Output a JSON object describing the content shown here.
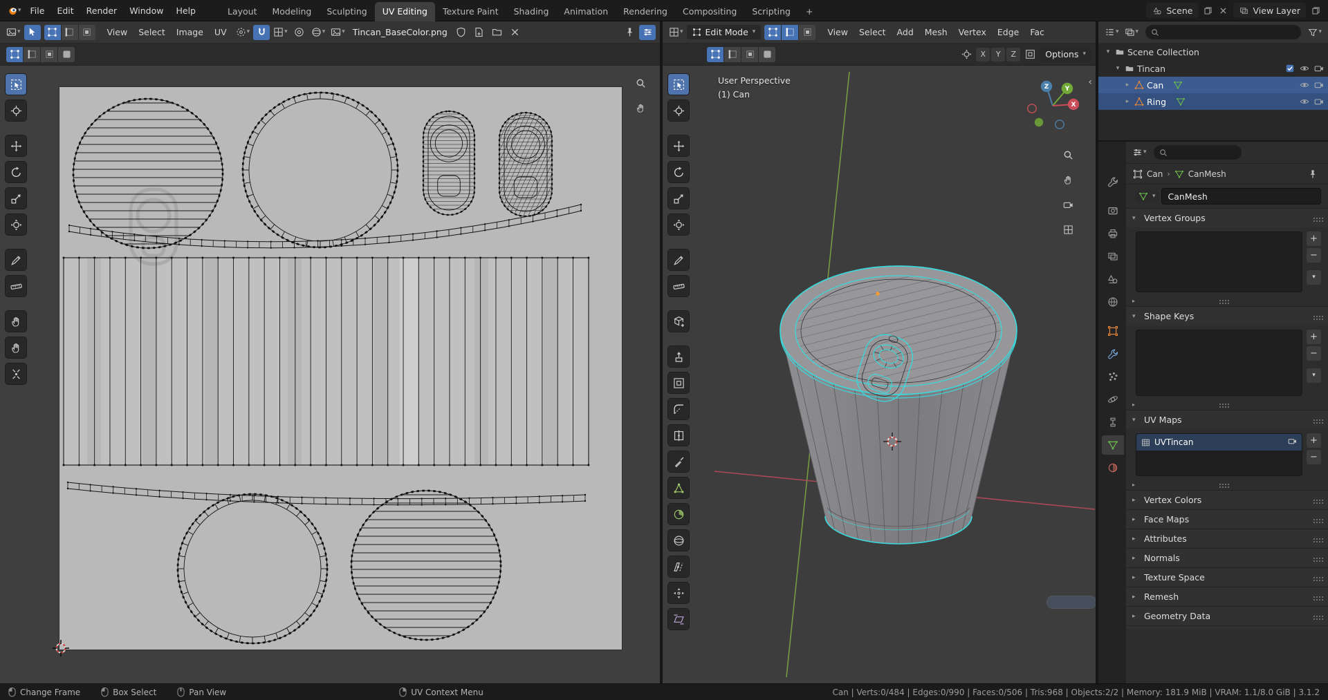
{
  "glyphs": {
    "caret": "▾",
    "right": "▸",
    "play": "▶",
    "close": "×",
    "plus": "+",
    "minus": "−",
    "chl": "‹",
    "sep": "›"
  },
  "topbar": {
    "menus": [
      "File",
      "Edit",
      "Render",
      "Window",
      "Help"
    ],
    "tabs": [
      "Layout",
      "Modeling",
      "Sculpting",
      "UV Editing",
      "Texture Paint",
      "Shading",
      "Animation",
      "Rendering",
      "Compositing",
      "Scripting"
    ],
    "add_tab": "+",
    "scene": "Scene",
    "view_layer": "View Layer"
  },
  "uv": {
    "menus": [
      "View",
      "Select",
      "Image",
      "UV"
    ],
    "image_name": "Tincan_BaseColor.png"
  },
  "viewport": {
    "mode": "Edit Mode",
    "menus": [
      "View",
      "Select",
      "Add",
      "Mesh",
      "Vertex",
      "Edge",
      "Fac"
    ],
    "overlay1": "User Perspective",
    "overlay2": "(1) Can",
    "axes": {
      "x": "X",
      "y": "Y",
      "z": "Z"
    },
    "toggles": [
      "X",
      "Y",
      "Z"
    ],
    "options": "Options"
  },
  "outliner": {
    "scene_collection": "Scene Collection",
    "collection": "Tincan",
    "can": "Can",
    "ring": "Ring"
  },
  "properties": {
    "breadcrumb_object": "Can",
    "breadcrumb_data": "CanMesh",
    "name": "CanMesh",
    "uv_item": "UVTincan",
    "panels": {
      "vertex_groups": "Vertex Groups",
      "shape_keys": "Shape Keys",
      "uv_maps": "UV Maps",
      "vertex_colors": "Vertex Colors",
      "face_maps": "Face Maps",
      "attributes": "Attributes",
      "normals": "Normals",
      "texture_space": "Texture Space",
      "remesh": "Remesh",
      "geometry_data": "Geometry Data"
    }
  },
  "statusbar": {
    "hints": [
      "Change Frame",
      "Box Select",
      "Pan View",
      "UV Context Menu"
    ],
    "stats": "Can | Verts:0/484 | Edges:0/990 | Faces:0/506 | Tris:968 | Objects:2/2 | Memory: 181.9 MiB | VRAM: 1.1/8.0 GiB | 3.1.2"
  }
}
